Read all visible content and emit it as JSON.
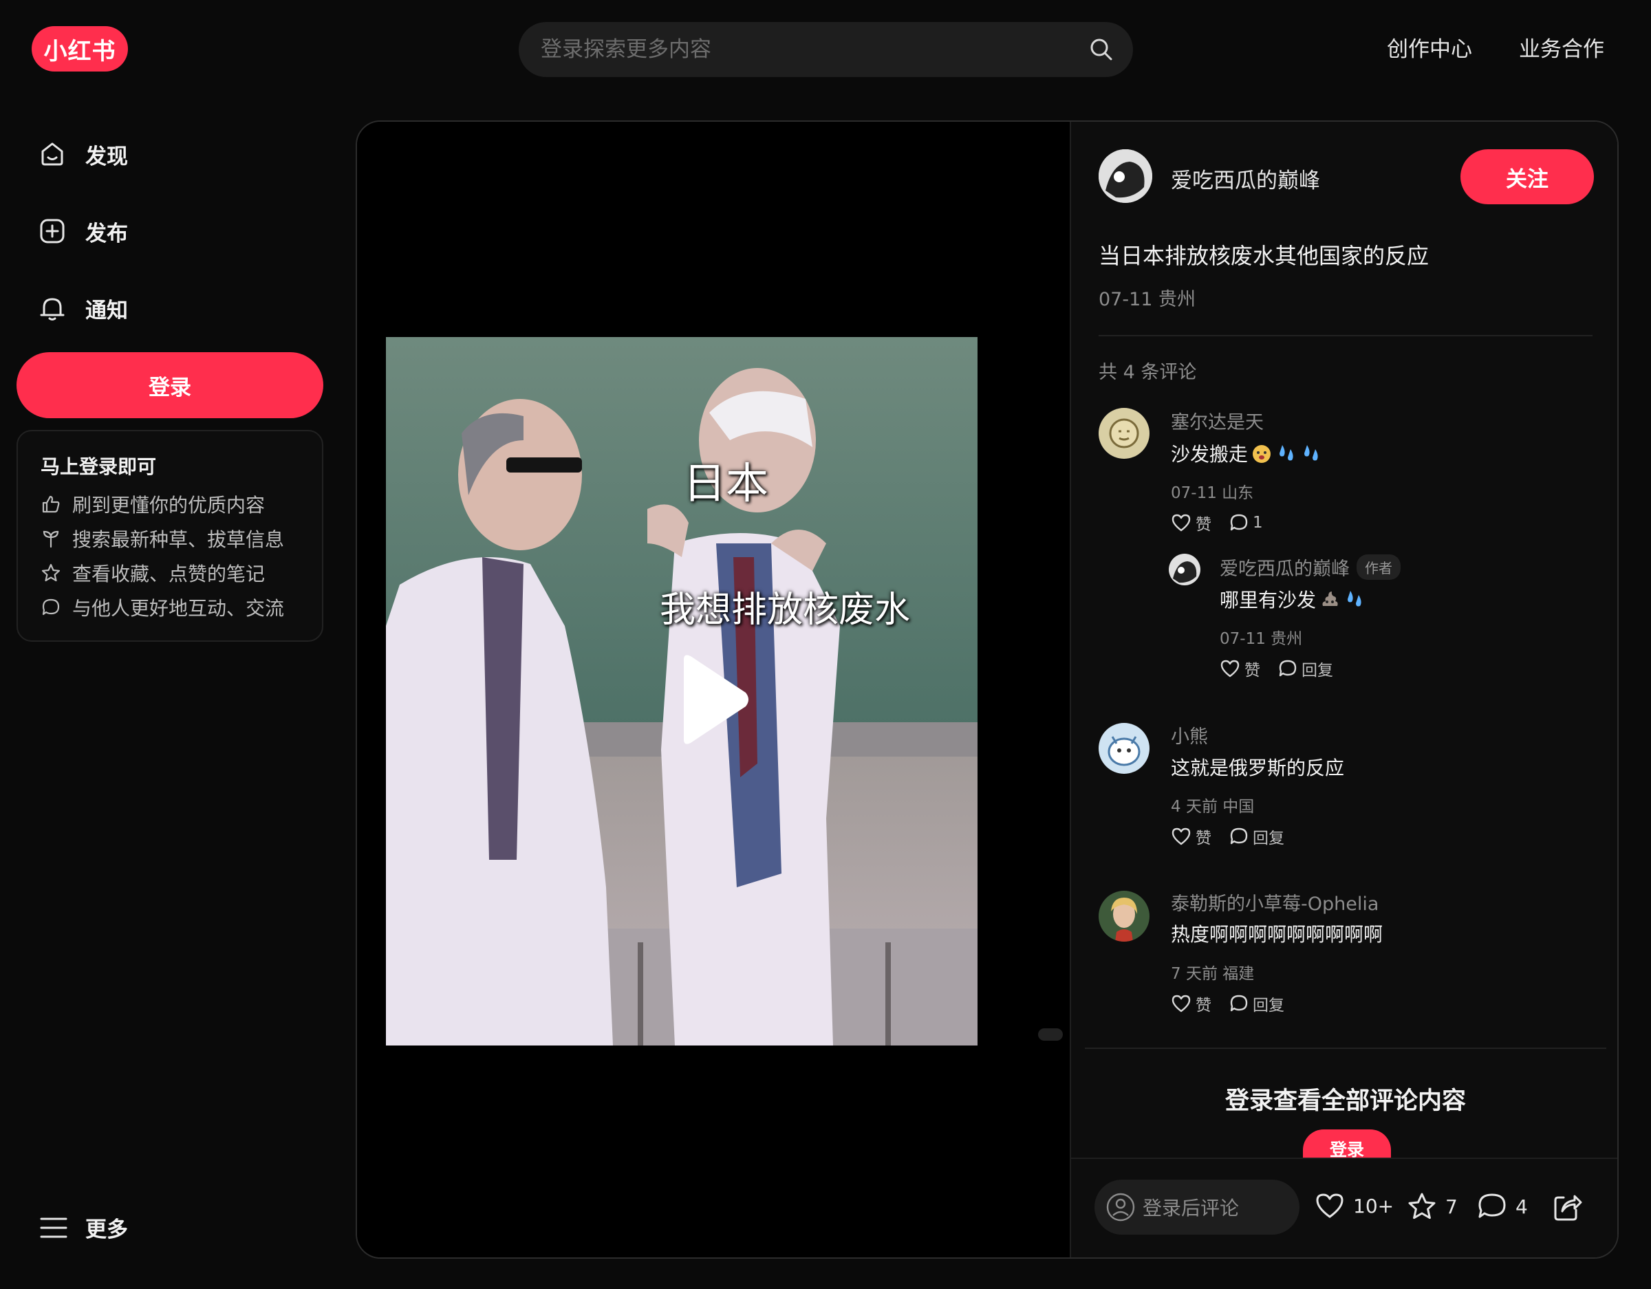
{
  "header": {
    "logo_text": "小红书",
    "search_placeholder": "登录探索更多内容",
    "links": [
      "创作中心",
      "业务合作"
    ]
  },
  "sidebar": {
    "items": [
      {
        "label": "发现",
        "icon": "home-icon"
      },
      {
        "label": "发布",
        "icon": "plus-square-icon"
      },
      {
        "label": "通知",
        "icon": "bell-icon"
      }
    ],
    "login_label": "登录",
    "promo": {
      "title": "马上登录即可",
      "rows": [
        {
          "text": "刷到更懂你的优质内容",
          "icon": "thumb-up-icon"
        },
        {
          "text": "搜索最新种草、拔草信息",
          "icon": "sprout-icon"
        },
        {
          "text": "查看收藏、点赞的笔记",
          "icon": "star-icon"
        },
        {
          "text": "与他人更好地互动、交流",
          "icon": "chat-bubble-icon"
        }
      ]
    },
    "more_label": "更多"
  },
  "video": {
    "caption_top": "日本",
    "caption_mid": "我想排放核废水"
  },
  "post": {
    "author": "爱吃西瓜的巅峰",
    "follow_label": "关注",
    "title": "当日本排放核废水其他国家的反应",
    "meta": "07-11 贵州",
    "comment_count_label": "共 4 条评论"
  },
  "comments": [
    {
      "name": "塞尔达是天",
      "text": "沙发搬走",
      "meta": "07-11 山东",
      "like": "赞",
      "reply": "1"
    },
    {
      "name": "爱吃西瓜的巅峰",
      "tag": "作者",
      "text": "哪里有沙发",
      "meta": "07-11 贵州",
      "like": "赞",
      "reply": "回复"
    },
    {
      "name": "小熊",
      "text": "这就是俄罗斯的反应",
      "meta": "4 天前 中国",
      "like": "赞",
      "reply": "回复"
    },
    {
      "name": "泰勒斯的小草莓-Ophelia",
      "text": "热度啊啊啊啊啊啊啊啊啊",
      "meta": "7 天前 福建",
      "like": "赞",
      "reply": "回复"
    }
  ],
  "login_prompt": "登录查看全部评论内容",
  "login_mini_label": "登录",
  "bottom": {
    "comment_placeholder": "登录后评论",
    "likes": "10+",
    "collects": "7",
    "comments": "4"
  },
  "colors": {
    "accent": "#ff2e4d",
    "background": "#0a0a0a"
  }
}
